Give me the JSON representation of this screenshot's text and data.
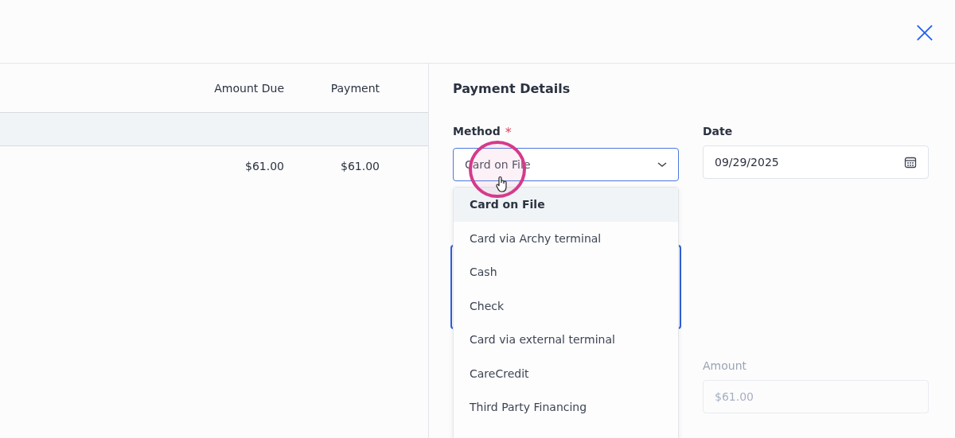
{
  "close_button": {
    "label": "×"
  },
  "table": {
    "columns": [
      "Amount Due",
      "Payment"
    ],
    "rows": [
      {
        "cells": [
          "$61.00",
          "$61.00"
        ]
      }
    ]
  },
  "payment_details": {
    "title": "Payment Details",
    "method": {
      "label": "Method",
      "required_mark": "*",
      "value": "Card on File",
      "open": true
    },
    "date": {
      "label": "Date",
      "value": "09/29/2025"
    },
    "amount": {
      "label": "Amount",
      "placeholder": "$61.00",
      "disabled": true
    },
    "options": [
      {
        "label": "Card on File",
        "selected": true
      },
      {
        "label": "Card via Archy terminal",
        "selected": false
      },
      {
        "label": "Cash",
        "selected": false
      },
      {
        "label": "Check",
        "selected": false
      },
      {
        "label": "Card via external terminal",
        "selected": false
      },
      {
        "label": "CareCredit",
        "selected": false
      },
      {
        "label": "Third Party Financing",
        "selected": false
      }
    ]
  }
}
